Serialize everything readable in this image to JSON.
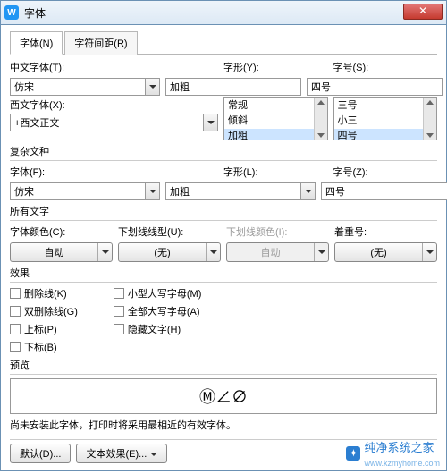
{
  "window": {
    "title": "字体"
  },
  "tabs": {
    "font": "字体(N)",
    "spacing": "字符间距(R)"
  },
  "labels": {
    "cnFont": "中文字体(T):",
    "enFont": "西文字体(X):",
    "style": "字形(Y):",
    "size": "字号(S):",
    "complex": "复杂文种",
    "complexFont": "字体(F):",
    "complexStyle": "字形(L):",
    "complexSize": "字号(Z):",
    "allText": "所有文字",
    "fontColor": "字体颜色(C):",
    "underlineStyle": "下划线线型(U):",
    "underlineColor": "下划线颜色(I):",
    "emphasis": "着重号:",
    "effects": "效果",
    "preview": "预览"
  },
  "values": {
    "cnFont": "仿宋",
    "enFont": "+西文正文",
    "style": "加粗",
    "size": "四号",
    "styleList": [
      "常规",
      "倾斜",
      "加粗"
    ],
    "sizeList": [
      "三号",
      "小三",
      "四号"
    ],
    "complexFont": "仿宋",
    "complexStyle": "加粗",
    "complexSize": "四号",
    "fontColor": "自动",
    "underlineStyle": "(无)",
    "underlineColor": "自动",
    "emphasis": "(无)"
  },
  "checks": {
    "strike": "删除线(K)",
    "dstrike": "双删除线(G)",
    "super": "上标(P)",
    "sub": "下标(B)",
    "smallcaps": "小型大写字母(M)",
    "allcaps": "全部大写字母(A)",
    "hidden": "隐藏文字(H)"
  },
  "previewText": "Ⓜ∠∅",
  "previewNote": "尚未安装此字体，打印时将采用最相近的有效字体。",
  "buttons": {
    "default": "默认(D)...",
    "textEffect": "文本效果(E)..."
  },
  "watermark": {
    "brand": "纯净系统之家",
    "url": "www.kzmyhome.com"
  }
}
